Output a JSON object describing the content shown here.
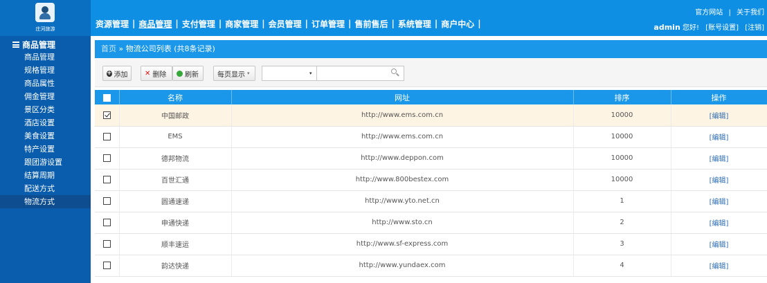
{
  "brand": {
    "logo_text": "庄河旅游"
  },
  "header": {
    "nav": [
      {
        "label": "资源管理",
        "active": false
      },
      {
        "label": "商品管理",
        "active": true
      },
      {
        "label": "支付管理",
        "active": false
      },
      {
        "label": "商家管理",
        "active": false
      },
      {
        "label": "会员管理",
        "active": false
      },
      {
        "label": "订单管理",
        "active": false
      },
      {
        "label": "售前售后",
        "active": false
      },
      {
        "label": "系统管理",
        "active": false
      },
      {
        "label": "商户中心",
        "active": false
      }
    ],
    "nav_separator": "|",
    "links": {
      "official_site": "官方网站",
      "separator": "|",
      "about": "关于我们"
    },
    "user": {
      "name": "admin",
      "greeting": "您好!",
      "account_settings": "[账号设置]",
      "logout": "[注销]"
    }
  },
  "sidebar": {
    "group_title": "商品管理",
    "items": [
      {
        "label": "商品管理",
        "active": false
      },
      {
        "label": "规格管理",
        "active": false
      },
      {
        "label": "商品属性",
        "active": false
      },
      {
        "label": "佣金管理",
        "active": false
      },
      {
        "label": "景区分类",
        "active": false
      },
      {
        "label": "酒店设置",
        "active": false
      },
      {
        "label": "美食设置",
        "active": false
      },
      {
        "label": "特产设置",
        "active": false
      },
      {
        "label": "跟团游设置",
        "active": false
      },
      {
        "label": "结算周期",
        "active": false
      },
      {
        "label": "配送方式",
        "active": false
      },
      {
        "label": "物流方式",
        "active": true
      }
    ]
  },
  "breadcrumb": {
    "home": "首页",
    "separator": " » ",
    "current": "物流公司列表 (共8条记录)"
  },
  "toolbar": {
    "add_label": "添加",
    "delete_label": "删除",
    "refresh_label": "刷新",
    "page_size_label": "每页显示",
    "page_size_caret": "▾",
    "search_select_value": "",
    "search_select_caret": "▾",
    "search_placeholder": ""
  },
  "table": {
    "columns": [
      "名称",
      "网址",
      "排序",
      "操作"
    ],
    "rows": [
      {
        "name": "中国邮政",
        "url": "http://www.ems.com.cn",
        "sort": "10000",
        "op": "[编辑]",
        "checked": true
      },
      {
        "name": "EMS",
        "url": "http://www.ems.com.cn",
        "sort": "10000",
        "op": "[编辑]",
        "checked": false
      },
      {
        "name": "德邦物流",
        "url": "http://www.deppon.com",
        "sort": "10000",
        "op": "[编辑]",
        "checked": false
      },
      {
        "name": "百世汇通",
        "url": "http://www.800bestex.com",
        "sort": "10000",
        "op": "[编辑]",
        "checked": false
      },
      {
        "name": "圆通速递",
        "url": "http://www.yto.net.cn",
        "sort": "1",
        "op": "[编辑]",
        "checked": false
      },
      {
        "name": "申通快递",
        "url": "http://www.sto.cn",
        "sort": "2",
        "op": "[编辑]",
        "checked": false
      },
      {
        "name": "顺丰速运",
        "url": "http://www.sf-express.com",
        "sort": "3",
        "op": "[编辑]",
        "checked": false
      },
      {
        "name": "韵达快递",
        "url": "http://www.yundaex.com",
        "sort": "4",
        "op": "[编辑]",
        "checked": false
      }
    ]
  },
  "colors": {
    "header_blue": "#0f8fe3",
    "sidebar_blue": "#0a5cad",
    "table_header_blue": "#1a97e8",
    "selected_row": "#fdf4e3",
    "link_blue": "#2a6bb0",
    "delete_red": "#d11111"
  }
}
